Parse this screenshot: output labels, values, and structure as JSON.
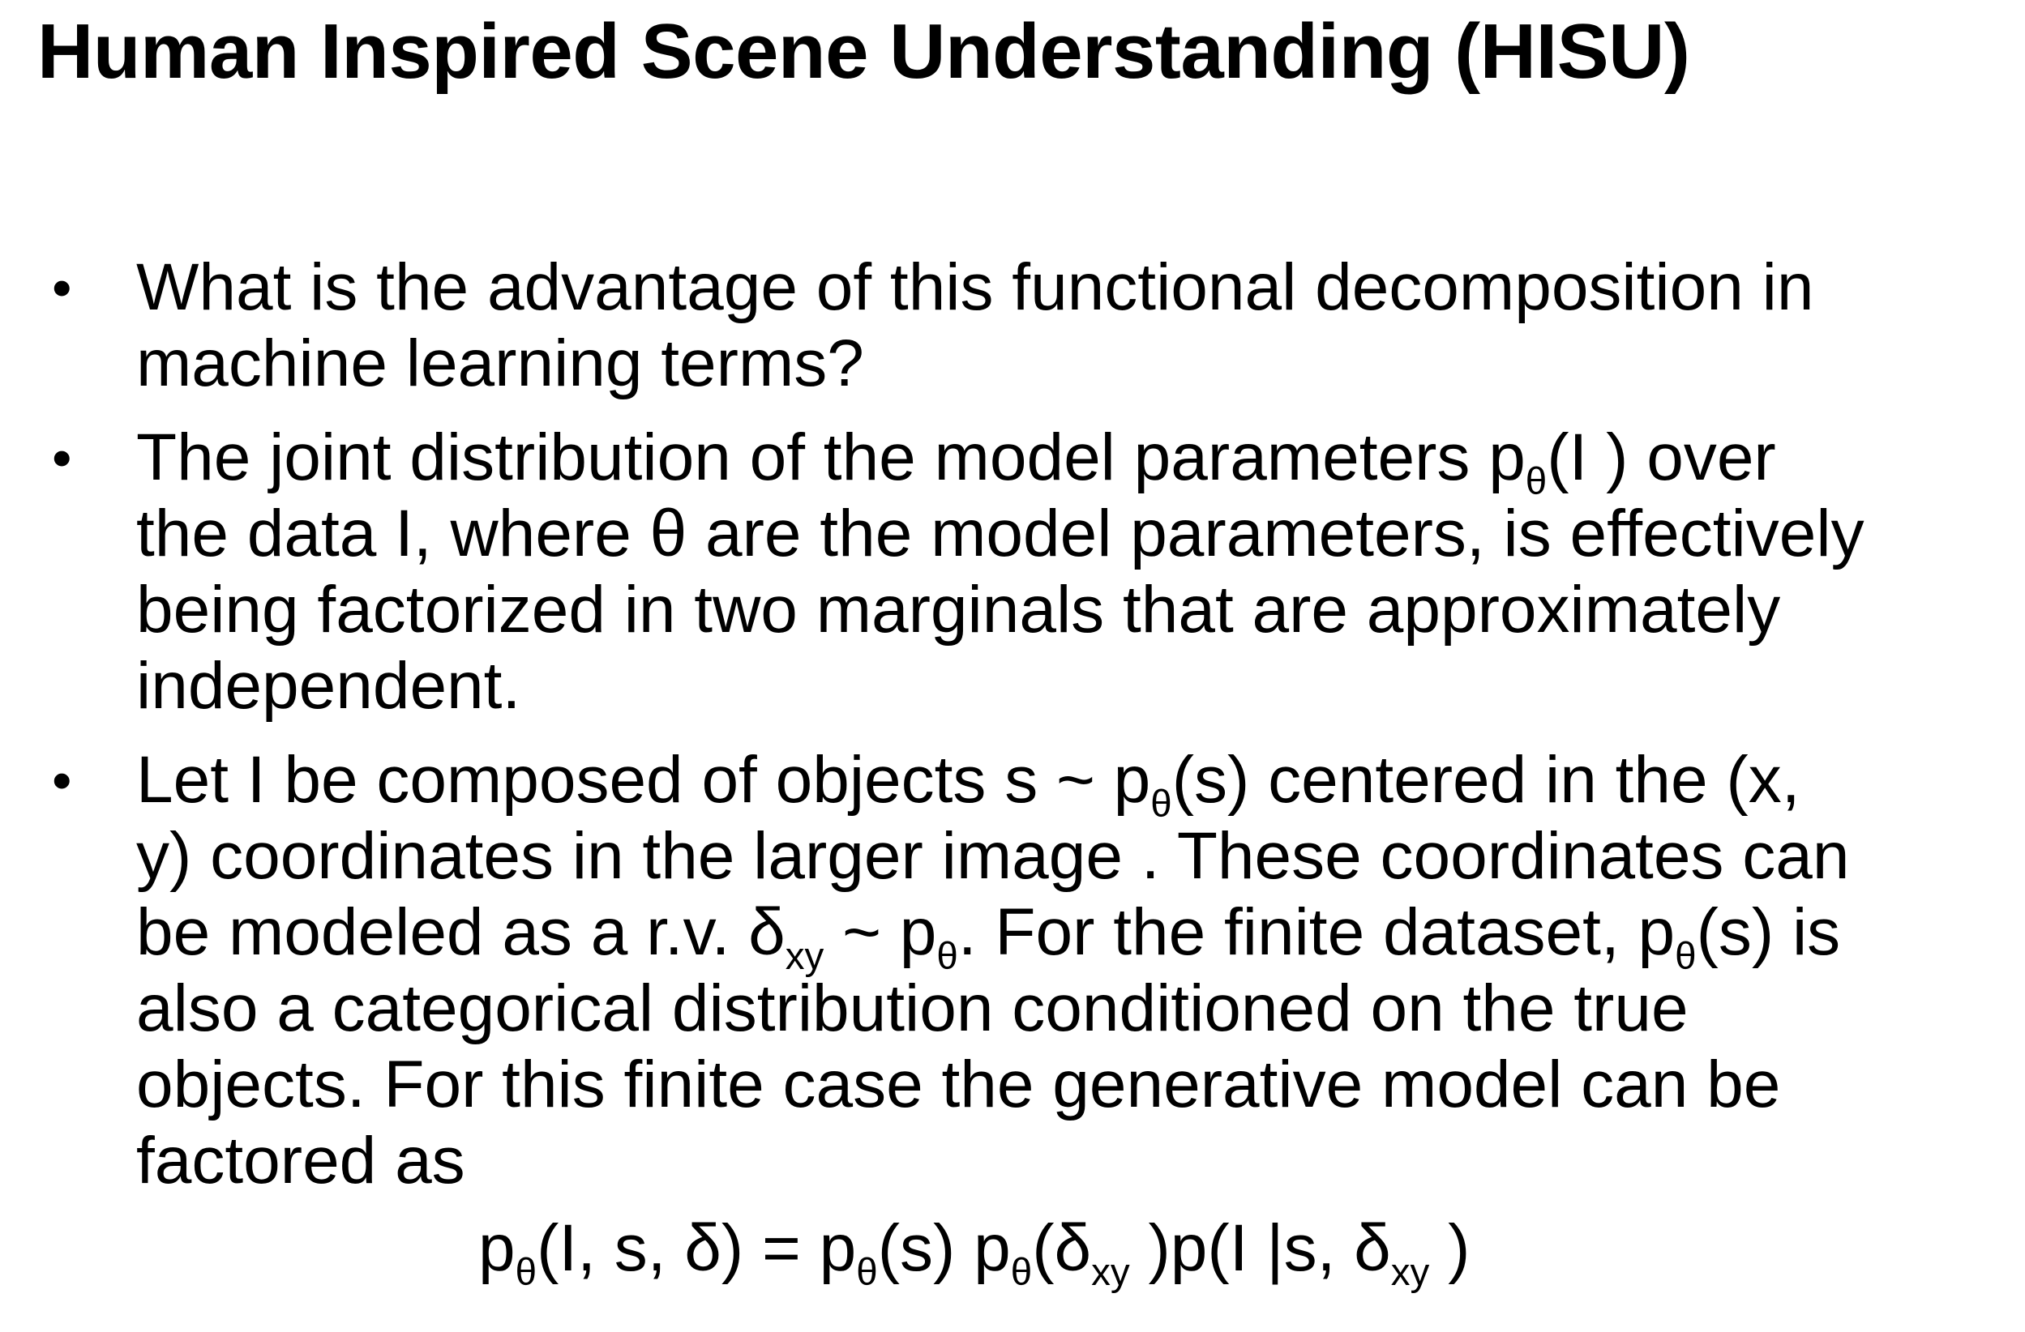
{
  "title": "Human Inspired Scene Understanding (HISU)",
  "bullet_marker": "•",
  "bullets": [
    {
      "lines": [
        "What is the advantage of this functional decomposition in",
        "machine learning terms?"
      ]
    },
    {
      "line1": {
        "a": "The joint distribution of the model parameters  p",
        "sub": "θ",
        "b": "(I ) over"
      },
      "lines": [
        "the data I, where θ are the model parameters, is effectively",
        "being factorized in two marginals that are approximately",
        "independent."
      ]
    },
    {
      "line1": {
        "a": "Let I be composed of objects s ~ p",
        "sub": "θ",
        "b": "(s) centered in the (x,"
      },
      "line2": "y) coordinates in the larger image . These coordinates can",
      "line3": {
        "a": "be modeled as a r.v. δ",
        "sub1": "xy",
        "b": " ~ p",
        "sub2": "θ",
        "c": ". For the finite dataset, p",
        "sub3": "θ",
        "d": "(s) is"
      },
      "lines": [
        "also a categorical distribution conditioned on the true",
        "objects. For this finite case the generative model can be",
        "factored as"
      ]
    }
  ],
  "equation": {
    "t1": "p",
    "s1": "θ",
    "t2": "(I, s, δ) = p",
    "s2": "θ",
    "t3": "(s) p",
    "s3": "θ",
    "t4": "(δ",
    "s4": "xy",
    "t5": " )p(I |s, δ",
    "s5": "xy",
    "t6": " )"
  }
}
